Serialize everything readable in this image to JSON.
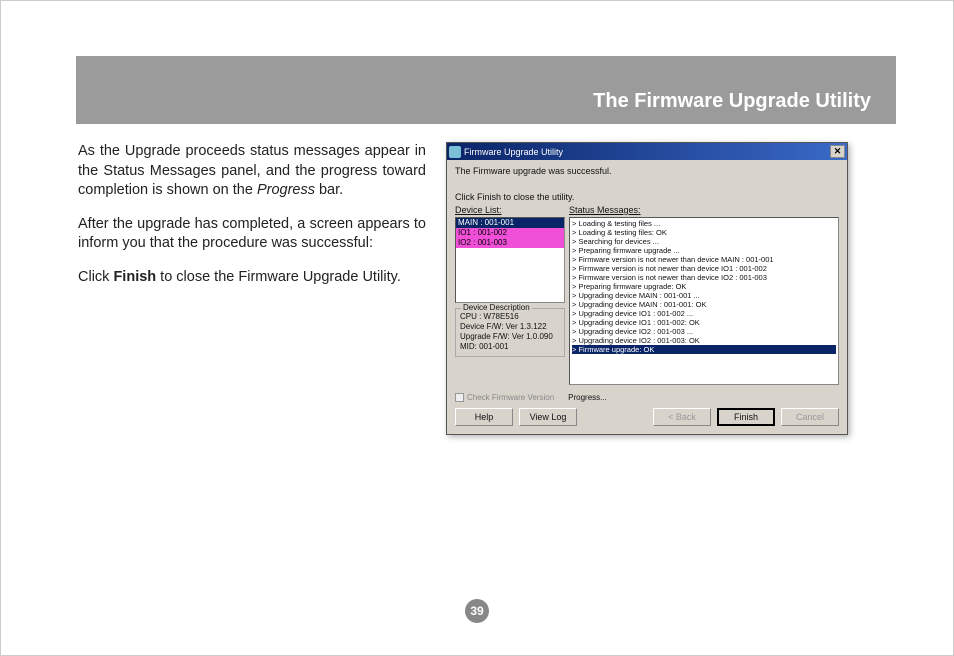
{
  "header": {
    "title": "The Firmware Upgrade Utility"
  },
  "body": {
    "p1a": "As the Upgrade proceeds status messages appear in the Status Messages panel, and the progress toward completion is shown on the ",
    "p1b": "Progress",
    "p1c": " bar.",
    "p2": "After the upgrade has completed, a screen appears to inform you that the procedure was successful:",
    "p3a": "Click ",
    "p3b": "Finish",
    "p3c": " to close the Firmware Upgrade Utility."
  },
  "window": {
    "title": "Firmware Upgrade Utility",
    "success": "The Firmware upgrade was successful.",
    "finish_hint": "Click Finish to close the utility.",
    "device_list_label": "Device List:",
    "status_label": "Status Messages:",
    "devices": [
      "MAIN : 001-001",
      "IO1 : 001-002",
      "IO2 : 001-003"
    ],
    "status_lines": [
      "> Loading & testing files ...",
      "> Loading & testing files: OK",
      "> Searching for devices ...",
      "> Preparing firmware upgrade ...",
      "> Firmware version is not newer than device MAIN : 001-001",
      "> Firmware version is not newer than device IO1 : 001-002",
      "> Firmware version is not newer than device IO2 : 001-003",
      "> Preparing firmware upgrade: OK",
      "> Upgrading device MAIN : 001-001 ...",
      "> Upgrading device MAIN : 001-001: OK",
      "> Upgrading device IO1 : 001-002 ...",
      "> Upgrading device IO1 : 001-002: OK",
      "> Upgrading device IO2 : 001-003 ...",
      "> Upgrading device IO2 : 001-003: OK",
      "> Firmware upgrade: OK"
    ],
    "desc": {
      "legend": "Device Description",
      "l1": "CPU : W78E516",
      "l2": "Device F/W: Ver 1.3.122",
      "l3": "Upgrade F/W: Ver 1.0.090",
      "l4": "MID: 001-001"
    },
    "check_label": "Check Firmware Version",
    "progress_label": "Progress...",
    "buttons": {
      "help": "Help",
      "viewlog": "View Log",
      "back": "< Back",
      "finish": "Finish",
      "cancel": "Cancel"
    }
  },
  "page_number": "39"
}
